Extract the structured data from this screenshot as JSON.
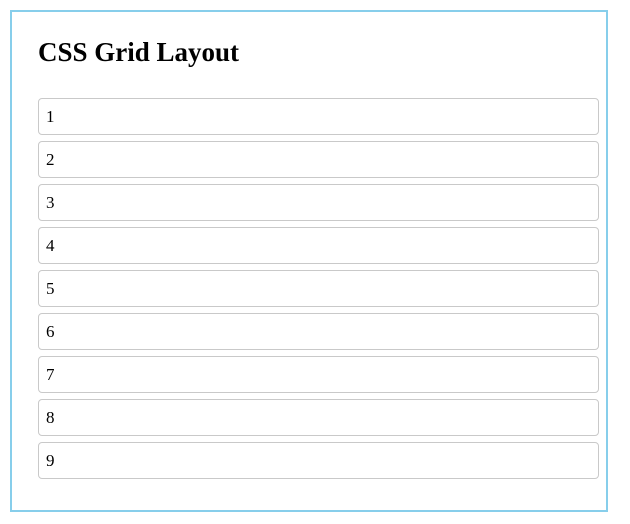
{
  "page": {
    "title": "CSS Grid Layout"
  },
  "grid": {
    "items": [
      "1",
      "2",
      "3",
      "4",
      "5",
      "6",
      "7",
      "8",
      "9"
    ]
  },
  "colors": {
    "frame_border": "#87ceeb",
    "cell_border": "#c9c9c9",
    "text": "#000000"
  }
}
